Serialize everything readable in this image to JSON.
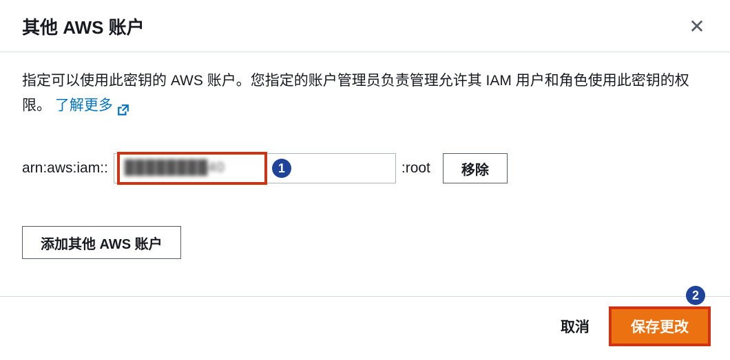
{
  "modal": {
    "title": "其他 AWS 账户",
    "close_label": "✕"
  },
  "body": {
    "description_text_1": "指定可以使用此密钥的 AWS 账户。您指定的账户管理员负责管理允许其 IAM 用户和角色使用此密钥的权限。",
    "learn_more_label": "了解更多",
    "arn_prefix": "arn:aws:iam::",
    "account_value": "",
    "account_masked_display": "████████40",
    "arn_suffix": ":root",
    "remove_label": "移除",
    "add_account_label": "添加其他 AWS 账户"
  },
  "footer": {
    "cancel_label": "取消",
    "save_label": "保存更改"
  },
  "callouts": {
    "one": "1",
    "two": "2"
  }
}
